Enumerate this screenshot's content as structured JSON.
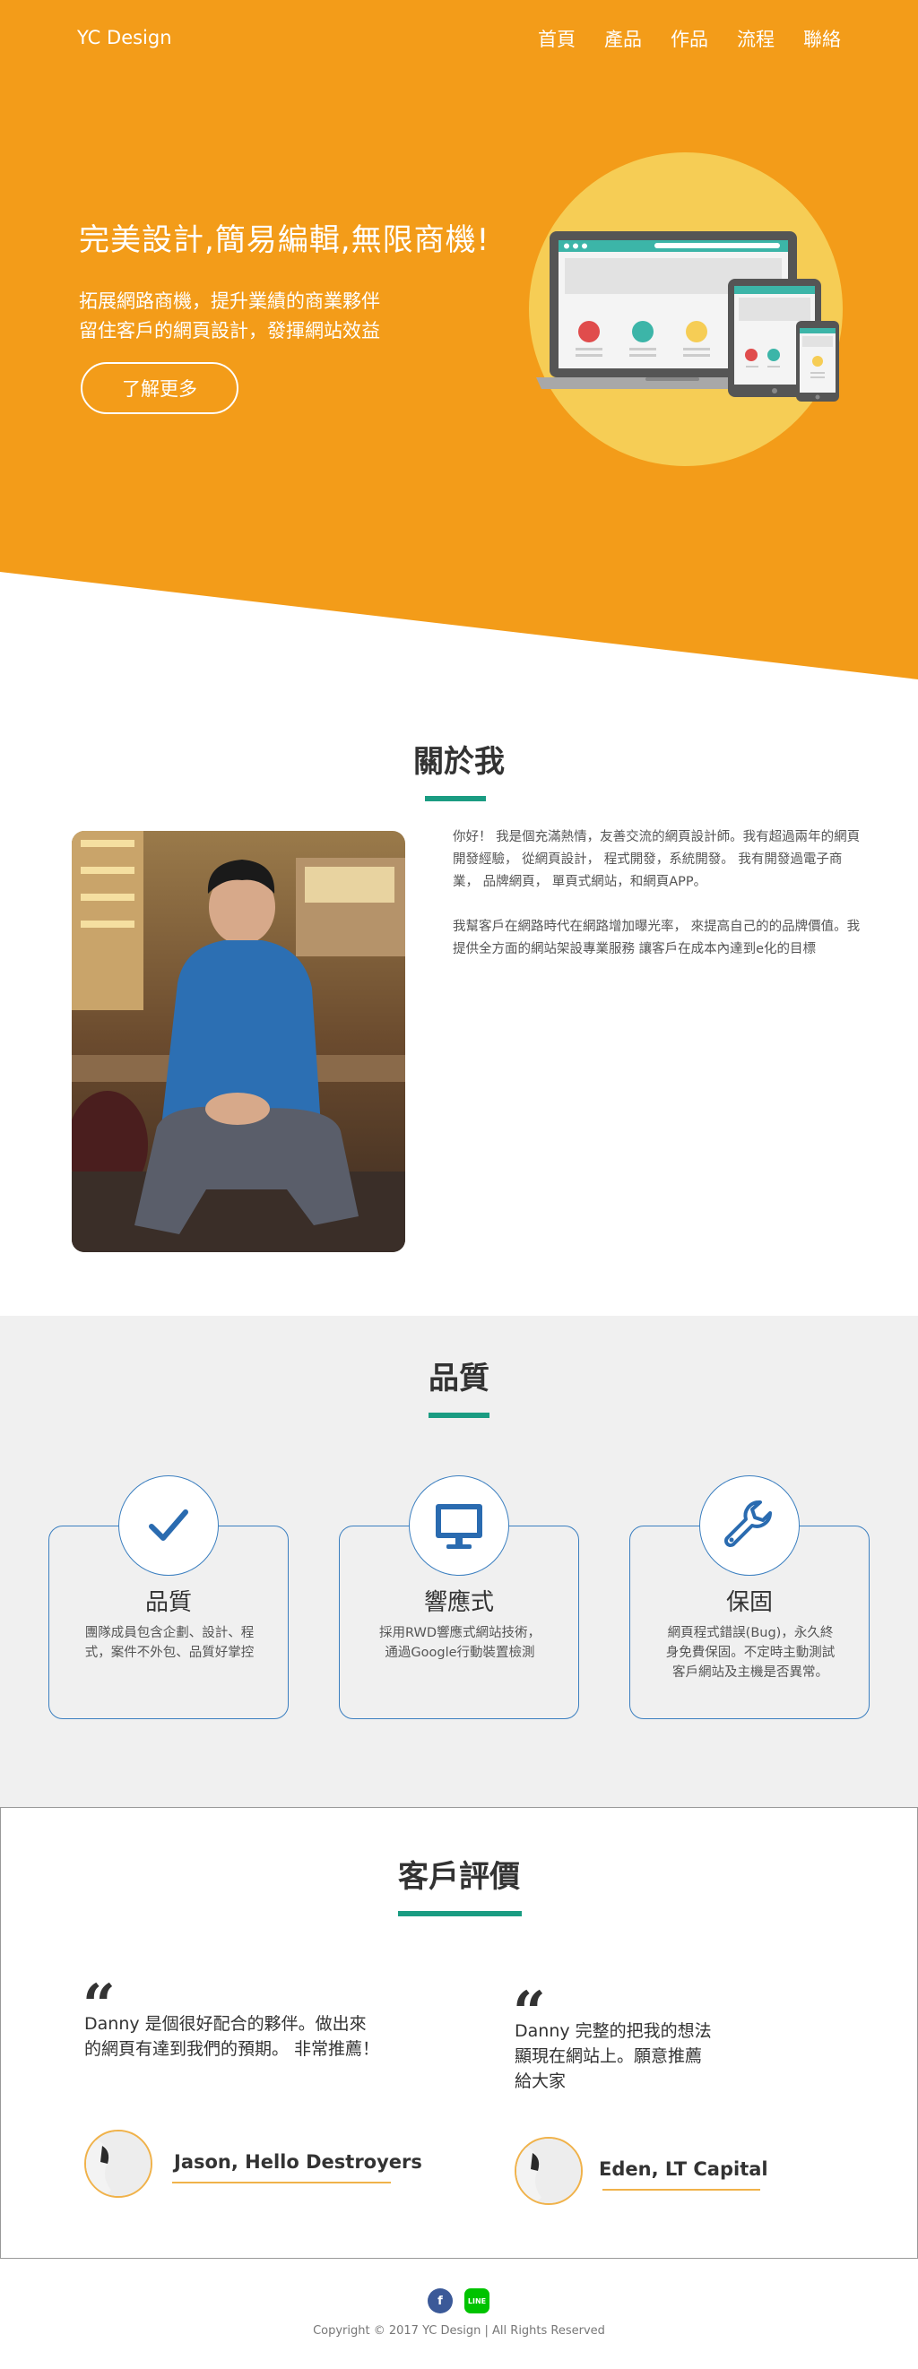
{
  "header": {
    "logo": "YC Design",
    "nav": [
      "首頁",
      "產品",
      "作品",
      "流程",
      "聯絡"
    ]
  },
  "hero": {
    "headline": "完美設計,簡易編輯,無限商機!",
    "sub_line1": "拓展網路商機，提升業績的商業夥伴",
    "sub_line2": "留住客戶的網頁設計，發揮網站效益",
    "cta": "了解更多"
  },
  "about": {
    "title": "關於我",
    "para1": "你好！ 我是個充滿熱情，友善交流的網頁設計師。我有超過兩年的網頁開發經驗， 從網頁設計， 程式開發，系統開發。 我有開發過電子商業， 品牌網頁， 單頁式網站，和網頁APP。",
    "para2": "我幫客戶在網路時代在網路增加曝光率， 來提高自己的的品牌價值。我提供全方面的網站架設專業服務 讓客戶在成本內達到e化的目標"
  },
  "quality": {
    "title": "品質",
    "cards": [
      {
        "title": "品質",
        "desc": "團隊成員包含企劃、設計、程式，案件不外包、品質好掌控",
        "icon": "check-icon"
      },
      {
        "title": "響應式",
        "desc": "採用RWD響應式網站技術，通過Google行動裝置檢測",
        "icon": "monitor-icon"
      },
      {
        "title": "保固",
        "desc": "網頁程式錯誤(Bug)，永久終身免費保固。不定時主動測試客戶網站及主機是否異常。",
        "icon": "wrench-icon"
      }
    ]
  },
  "testimonials": {
    "title": "客戶評價",
    "items": [
      {
        "quote_line1": "Danny 是個很好配合的夥伴。做出來",
        "quote_line2": "的網頁有達到我們的預期。 非常推薦！",
        "quote_line3": "",
        "name": "Jason, Hello Destroyers"
      },
      {
        "quote_line1": "Danny 完整的把我的想法",
        "quote_line2": "顯現在網站上。願意推薦",
        "quote_line3": "給大家",
        "name": "Eden, LT Capital"
      }
    ]
  },
  "footer": {
    "facebook_label": "f",
    "line_label": "LINE",
    "copyright": "Copyright © 2017 YC Design | All Rights Reserved"
  },
  "colors": {
    "hero_orange": "#f39c19",
    "circle_yellow": "#f6cd55",
    "accent_green": "#1a9c82",
    "card_blue": "#3b7fc0",
    "quote_gold": "#f0b24a",
    "facebook_blue": "#3b5998",
    "line_green": "#00c300"
  }
}
